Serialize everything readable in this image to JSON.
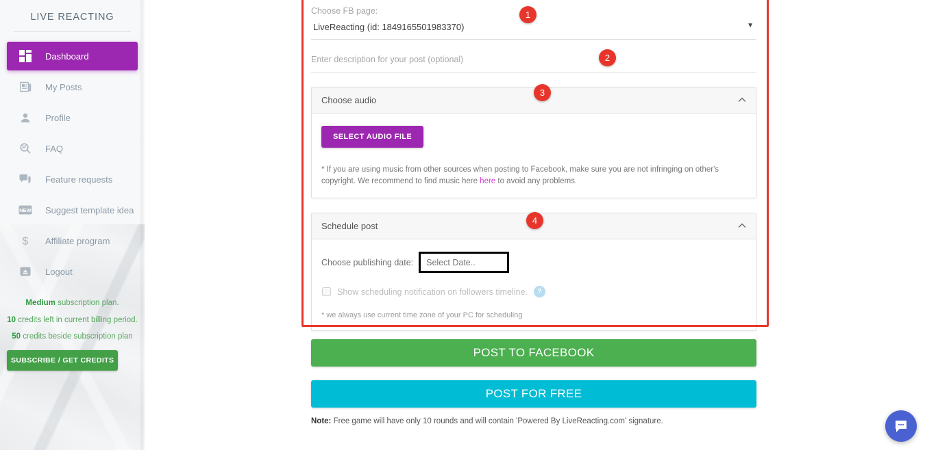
{
  "sidebar": {
    "brand": "LIVE REACTING",
    "items": [
      {
        "label": "Dashboard",
        "icon": "dashboard-grid-icon",
        "active": true
      },
      {
        "label": "My Posts",
        "icon": "articles-icon",
        "active": false
      },
      {
        "label": "Profile",
        "icon": "person-icon",
        "active": false
      },
      {
        "label": "FAQ",
        "icon": "faq-search-icon",
        "active": false
      },
      {
        "label": "Feature requests",
        "icon": "chat-bubbles-icon",
        "active": false
      },
      {
        "label": "Suggest template idea",
        "icon": "new-badge-icon",
        "active": false
      },
      {
        "label": "Affiliate program",
        "icon": "dollar-icon",
        "active": false
      },
      {
        "label": "Logout",
        "icon": "logout-icon",
        "active": false
      }
    ],
    "credits": {
      "plan_name": "Medium",
      "plan_suffix": " subscription plan.",
      "remaining_count": "10",
      "remaining_suffix": " credits left in current billing period.",
      "extra_count": "50",
      "extra_suffix": " credits beside subscription plan",
      "subscribe_label": "SUBSCRIBE / GET CREDITS"
    }
  },
  "form": {
    "fb_page": {
      "label": "Choose FB page:",
      "value": "LiveReacting (id: 1849165501983370)",
      "caret": "▼"
    },
    "description": {
      "placeholder": "Enter description for your post (optional)",
      "value": ""
    },
    "audio_panel": {
      "title": "Choose audio",
      "select_button": "SELECT AUDIO FILE",
      "note_part1": "* If you are using music from other sources when posting to Facebook, make sure you are not infringing on other's copyright. We recommend to find music here ",
      "note_link": "here",
      "note_part2": " to avoid any problems."
    },
    "schedule_panel": {
      "title": "Schedule post",
      "date_label": "Choose publishing date:",
      "date_placeholder": "Select Date..",
      "date_value": "",
      "checkbox_label": "Show scheduling notification on followers timeline.",
      "checkbox_checked": false,
      "help_icon_text": "?",
      "timezone_note": "* we always use current time zone of your PC for scheduling"
    }
  },
  "actions": {
    "post_to_facebook": "POST TO FACEBOOK",
    "post_for_free": "POST FOR FREE",
    "note_prefix": "Note:",
    "note_text": " Free game will have only 10 rounds and will contain 'Powered By LiveReacting.com' signature."
  },
  "annotations": {
    "badge_1": "1",
    "badge_2": "2",
    "badge_3": "3",
    "badge_4": "4"
  },
  "colors": {
    "accent_purple": "#9c27b0",
    "green": "#4caf50",
    "cyan": "#00bcd4",
    "highlight_red": "#e8352b",
    "chat_blue": "#4a61d1"
  }
}
